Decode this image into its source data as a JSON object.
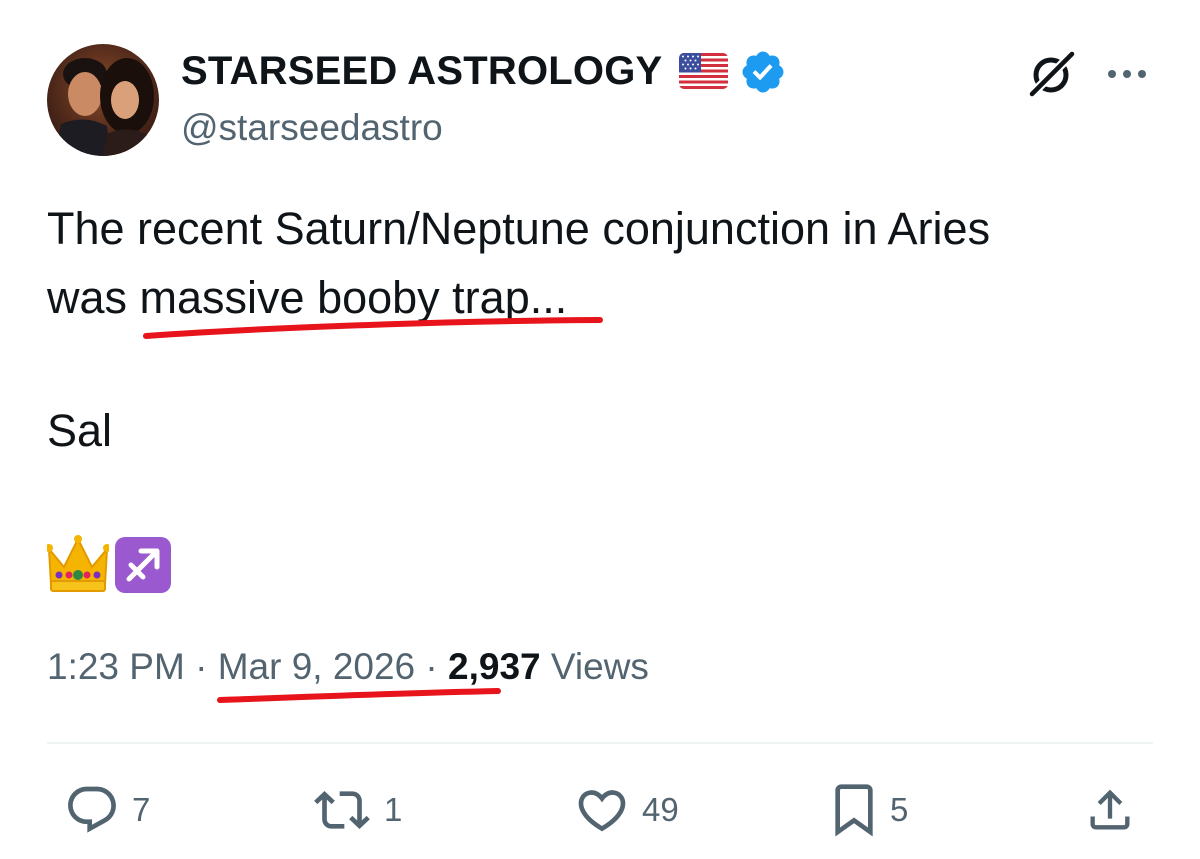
{
  "post": {
    "author": {
      "display_name": "STARSEED ASTROLOGY",
      "handle": "@starseedastro",
      "flag_icon": "us-flag-icon",
      "verified_icon": "verified-badge-icon"
    },
    "header_actions": {
      "grok_icon": "grok-icon",
      "more_icon": "more-icon"
    },
    "text": {
      "line1": "The recent Saturn/Neptune conjunction in Aries",
      "line2_prefix": "was ",
      "line2_highlight": "massive booby trap...",
      "line3": "Sal"
    },
    "emojis": [
      "crown-icon",
      "sagittarius-icon"
    ],
    "meta": {
      "time": "1:23 PM",
      "separator": "·",
      "date": "Mar 9, 2026",
      "views_count": "2,937",
      "views_label": "Views"
    },
    "actions": {
      "replies": "7",
      "reposts": "1",
      "likes": "49",
      "bookmarks": "5"
    },
    "colors": {
      "text": "#0f1419",
      "secondary": "#536471",
      "verified": "#1d9bf0",
      "annotation": "#e8141b",
      "divider": "#eff3f4"
    }
  }
}
